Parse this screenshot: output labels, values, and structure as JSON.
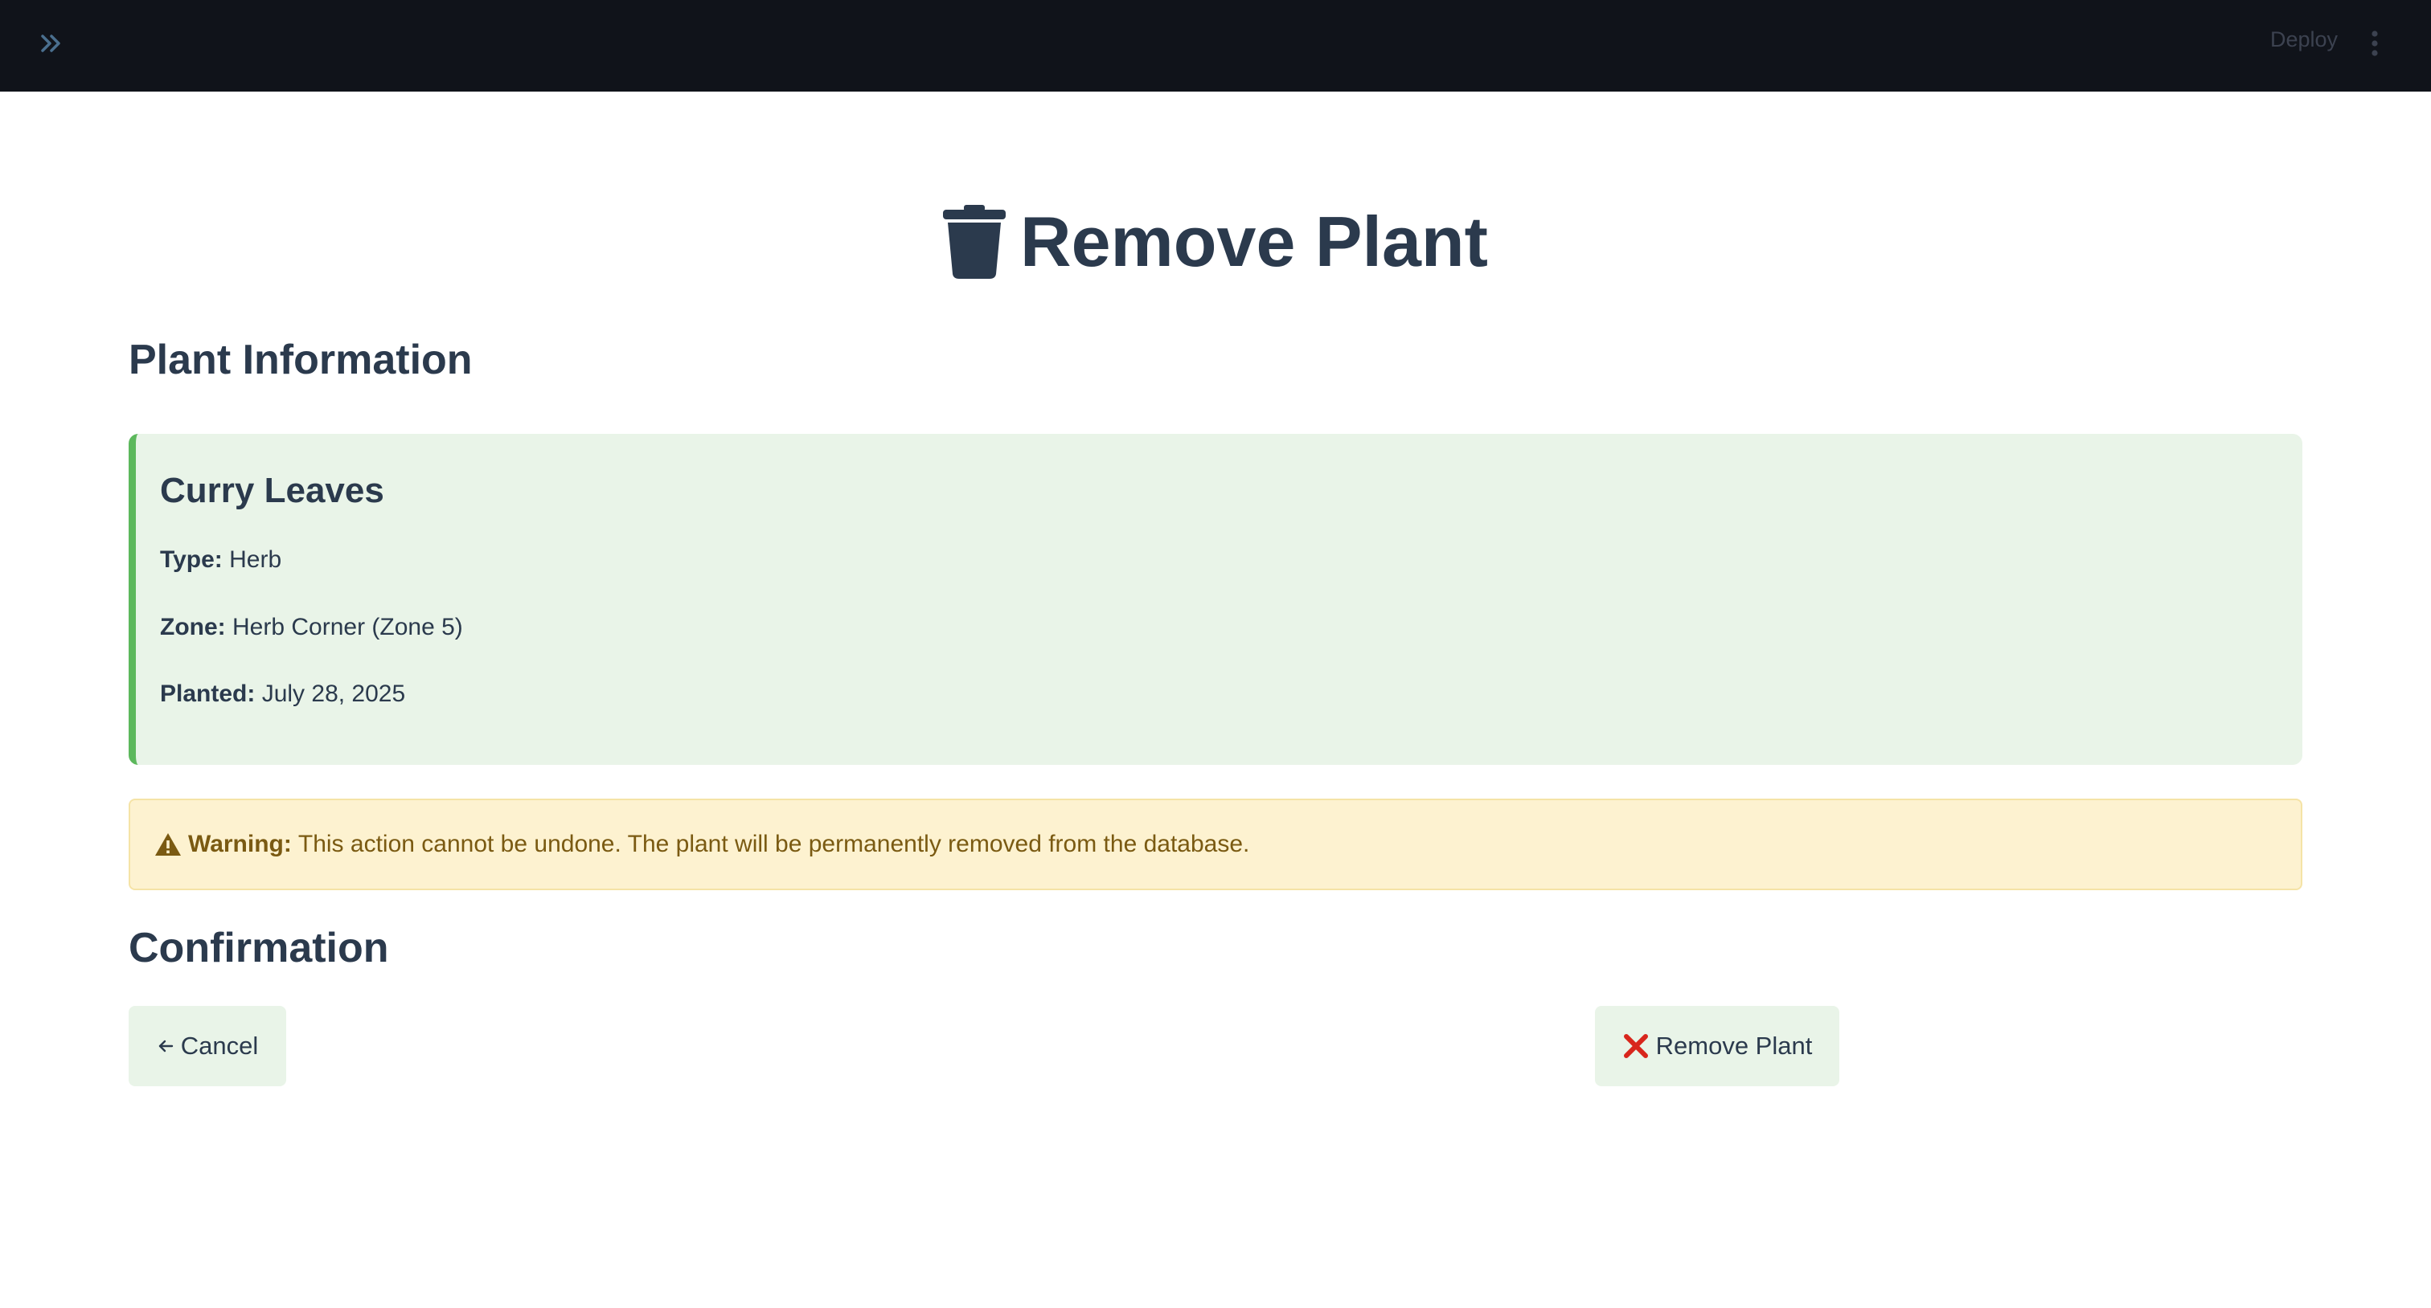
{
  "topbar": {
    "deploy_label": "Deploy",
    "expand_icon": "double-chevron-right-icon",
    "menu_icon": "vertical-ellipsis-icon"
  },
  "page": {
    "title": "Remove Plant",
    "title_icon": "trash-icon"
  },
  "plant_info": {
    "heading": "Plant Information",
    "name": "Curry Leaves",
    "type_label": "Type:",
    "type_value": "Herb",
    "zone_label": "Zone:",
    "zone_value": "Herb Corner (Zone 5)",
    "planted_label": "Planted:",
    "planted_value": "July 28, 2025",
    "accent_color": "#5cb85c"
  },
  "warning": {
    "icon": "warning-triangle-icon",
    "label": "Warning:",
    "text": "This action cannot be undone. The plant will be permanently removed from the database."
  },
  "confirmation": {
    "heading": "Confirmation",
    "cancel_label": "Cancel",
    "cancel_icon": "arrow-left-icon",
    "remove_label": "Remove Plant",
    "remove_icon": "red-x-icon"
  },
  "colors": {
    "topbar_bg": "#10131a",
    "card_bg": "#e9f4e8",
    "warning_bg": "#fdf2d0",
    "text": "#2b3a4d",
    "remove_icon": "#d8261c"
  }
}
